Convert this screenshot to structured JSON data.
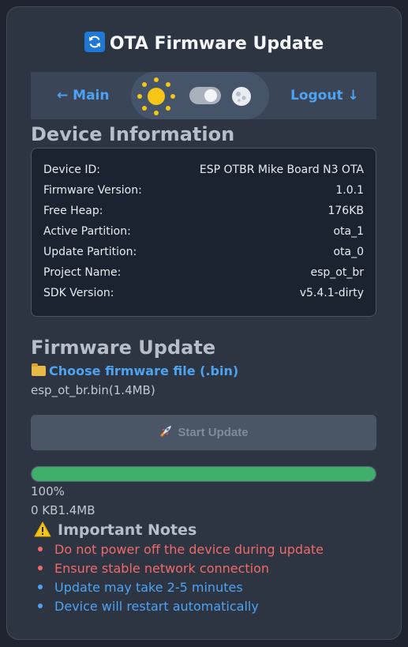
{
  "header": {
    "title": "OTA Firmware Update",
    "icon": "refresh-icon"
  },
  "nav": {
    "main_label": "← Main",
    "logout_label": "Logout ↓",
    "theme": {
      "mode": "light",
      "sun_icon": "sun-icon",
      "moon_icon": "moon-icon"
    }
  },
  "device_info": {
    "heading": "Device Information",
    "rows": [
      {
        "label": "Device ID:",
        "value": "ESP OTBR Mike Board N3 OTA"
      },
      {
        "label": "Firmware Version:",
        "value": "1.0.1"
      },
      {
        "label": "Free Heap:",
        "value": "176KB"
      },
      {
        "label": "Active Partition:",
        "value": "ota_1"
      },
      {
        "label": "Update Partition:",
        "value": "ota_0"
      },
      {
        "label": "Project Name:",
        "value": "esp_ot_br"
      },
      {
        "label": "SDK Version:",
        "value": "v5.4.1-dirty"
      }
    ]
  },
  "firmware_update": {
    "heading": "Firmware Update",
    "choose_label": "Choose firmware file (.bin)",
    "selected_file": "esp_ot_br.bin(1.4MB)",
    "start_label": "Start Update",
    "progress_fraction": 1.0,
    "progress_text": "100%",
    "size_text": "0 KB1.4MB"
  },
  "notes": {
    "heading": "Important Notes",
    "items": [
      {
        "text": "Do not power off the device during update",
        "color": "#f06a6a"
      },
      {
        "text": "Ensure stable network connection",
        "color": "#f06a6a"
      },
      {
        "text": "Update may take 2-5 minutes",
        "color": "#4da3f2"
      },
      {
        "text": "Device will restart automatically",
        "color": "#4da3f2"
      }
    ]
  },
  "colors": {
    "accent": "#4da3f2",
    "progress": "#3fae6b",
    "warning": "#f06a6a",
    "background": "#2d3442"
  }
}
